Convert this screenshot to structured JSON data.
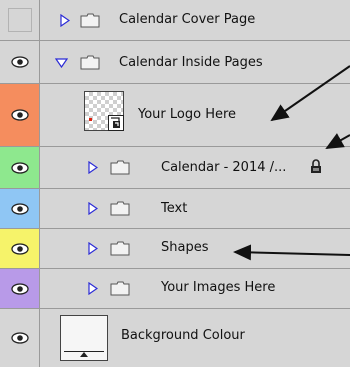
{
  "layers": [
    {
      "label": "Calendar Cover Page",
      "visible": false,
      "expanded": false,
      "kind": "group",
      "eye_color": "#d6d6d6"
    },
    {
      "label": "Calendar Inside Pages",
      "visible": true,
      "expanded": true,
      "kind": "group",
      "eye_color": "#d6d6d6"
    },
    {
      "label": "Your Logo Here",
      "visible": true,
      "kind": "smart-object",
      "eye_color": "#f58d5e"
    },
    {
      "label": "Calendar - 2014 /...",
      "visible": true,
      "expanded": false,
      "kind": "group",
      "locked": true,
      "eye_color": "#8ee88e"
    },
    {
      "label": "Text",
      "visible": true,
      "expanded": false,
      "kind": "group",
      "eye_color": "#8fc6f4"
    },
    {
      "label": "Shapes",
      "visible": true,
      "expanded": false,
      "kind": "group",
      "eye_color": "#f6f36a"
    },
    {
      "label": "Your Images Here",
      "visible": true,
      "expanded": false,
      "kind": "group",
      "eye_color": "#b89ae8"
    },
    {
      "label": "Background Colour",
      "visible": true,
      "kind": "layer",
      "eye_color": "#d6d6d6"
    }
  ],
  "icons": {
    "eye": "eye-icon",
    "triangle": "expand-triangle-icon",
    "folder": "folder-icon",
    "lock": "lock-icon",
    "arrow": "annotation-arrow"
  }
}
